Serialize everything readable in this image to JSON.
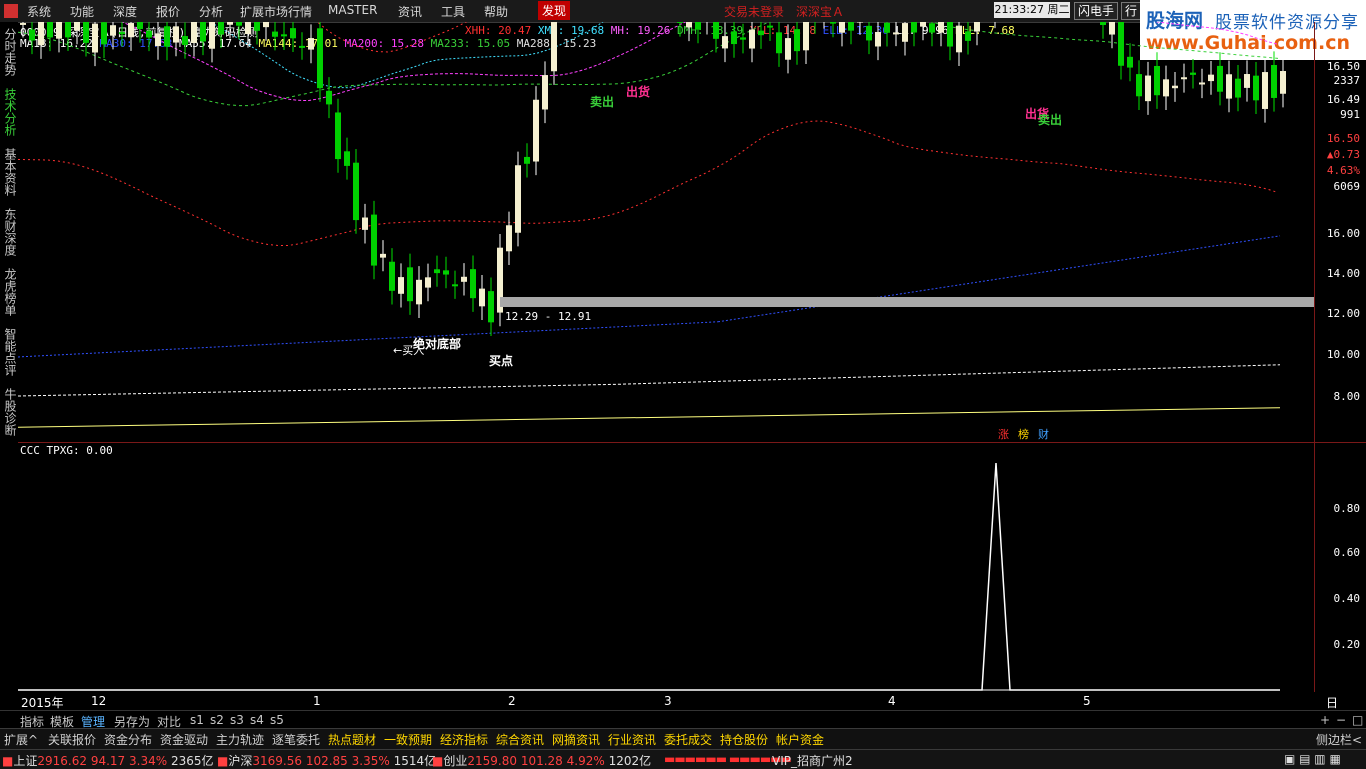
{
  "menu": [
    "系统",
    "功能",
    "深度",
    "报价",
    "分析",
    "扩展市场行情",
    "MASTER",
    "资讯",
    "工具",
    "帮助",
    "发现"
  ],
  "menu_active": "发现",
  "login": {
    "status": "交易未登录",
    "stock": "深深宝Ａ"
  },
  "clock": {
    "time": "21:33:27",
    "weekday": "周二"
  },
  "top_buttons": [
    "闪电手",
    "行"
  ],
  "logo": {
    "brand": "股海网",
    "slogan": "股票软件资源分享",
    "url": "www.Guhai.com.cn"
  },
  "left_tabs": [
    "分时走势",
    "技术分析",
    "基本资料",
    "东财深度",
    "龙虎榜单",
    "智能点评",
    "牛股诊断"
  ],
  "left_tab_active": "技术分析",
  "header": {
    "code": "000019",
    "name": "深深宝Ａ",
    "period": "(日线,前复权)",
    "indicator": "富力筹码检测",
    "xhh": "XHH: 20.47",
    "xmh": "XMH: 19.68",
    "mh": "MH: 19.26",
    "dmh": "DMH: 18.39",
    "yll": "YLL: 14.98",
    "ell": "ELL: 12.36",
    "ll": "LL: 9.96",
    "dll": "DLL: 7.68",
    "ma18": "MA18: 16.22",
    "ma30": "MA30: 17.63",
    "ma55": "MA55: 17.64",
    "ma144": "MA144: 17.01",
    "ma200": "MA200: 15.28",
    "ma233": "MA233: 15.05",
    "ma288": "MA288: 15.23"
  },
  "colors": {
    "up": "#ff3030",
    "down": "#00e000",
    "ma18": "#ffffff",
    "ma30": "#3050ff",
    "ma55": "#ffffff",
    "ma144": "#ffff60",
    "ma200": "#ff40ff",
    "ma233": "#39d039",
    "ma288": "#e0e0e0"
  },
  "annotations": {
    "sell1": "卖出",
    "ship1": "出货",
    "ship2": "出货",
    "sell2": "卖出",
    "bottom": "绝对底部",
    "buy_in": "←买入",
    "buy_point": "买点",
    "range": "12.29 - 12.91"
  },
  "tags": [
    "涨",
    "榜",
    "财"
  ],
  "price_axis": [
    "16.50",
    "16.49",
    "16.50",
    "16.00",
    "14.00",
    "12.00",
    "10.00",
    "8.00"
  ],
  "side_info": {
    "vol": "2337",
    "amt": "991",
    "chg": "▲0.73",
    "pct": "4.63%",
    "shares": "6069"
  },
  "indicator_panel": {
    "label": "CCC",
    "name": "TPXG:",
    "value": "0.00",
    "ticks": [
      "0.80",
      "0.60",
      "0.40",
      "0.20"
    ]
  },
  "chart_data": {
    "type": "line",
    "series": [
      {
        "name": "TPXG",
        "x": [
          "2015-12",
          "2016-01",
          "2016-02",
          "2016-03",
          "2016-04",
          "2016-04b",
          "2016-05"
        ],
        "values": [
          0,
          0,
          0,
          0,
          0,
          1.0,
          0
        ]
      }
    ],
    "ylim": [
      0,
      1.0
    ]
  },
  "x_axis": [
    "2015年",
    "12",
    "1",
    "2",
    "3",
    "4",
    "5",
    "日线"
  ],
  "bottom_tabs": [
    "指标",
    "模板",
    "管理",
    "另存为",
    "对比",
    "s1",
    "s2",
    "s3",
    "s4",
    "s5"
  ],
  "bottom_tab_active": "管理",
  "zoom_buttons": [
    "+",
    "−",
    "□"
  ],
  "funcbar": [
    "扩展^",
    "关联报价",
    "资金分布",
    "资金驱动",
    "主力轨迹",
    "逐笔委托",
    "热点题材",
    "一致预期",
    "经济指标",
    "综合资讯",
    "网摘资讯",
    "行业资讯",
    "委托成交",
    "持仓股份",
    "帐户资金"
  ],
  "funcbar_hot": [
    "热点题材",
    "一致预期",
    "经济指标",
    "综合资讯",
    "网摘资讯",
    "行业资讯",
    "委托成交",
    "持仓股份",
    "帐户资金"
  ],
  "sidebar_toggle": "侧边栏<",
  "status": {
    "sh_name": "上证",
    "sh_val": "2916.62",
    "sh_chg": "94.17",
    "sh_pct": "3.34%",
    "sh_amt": "2365亿",
    "hs_name": "沪深",
    "hs_val": "3169.56",
    "hs_chg": "102.85",
    "hs_pct": "3.35%",
    "hs_amt": "1514亿",
    "cy_name": "创业",
    "cy_val": "2159.80",
    "cy_chg": "101.28",
    "cy_pct": "4.92%",
    "cy_amt": "1202亿",
    "server": "VIP_招商广州2"
  }
}
